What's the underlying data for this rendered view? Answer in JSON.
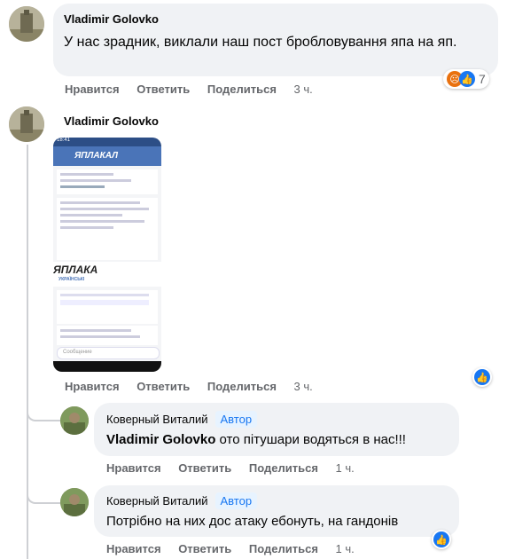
{
  "comments": [
    {
      "author": "Vladimir Golovko",
      "text": "У нас зрадник, виклали наш пост бробловування япа на яп.",
      "actions": {
        "like": "Нравится",
        "reply": "Ответить",
        "share": "Поделиться",
        "time": "3 ч."
      },
      "reaction_count": "7",
      "reaction_icons": [
        "angry-icon",
        "like-icon"
      ]
    },
    {
      "author": "Vladimir Golovko",
      "attachment": {
        "status_time": "18:41",
        "logo": "ЯПЛАКАЛ",
        "brand": "ЯПЛАКА",
        "brand_sub": "УКРАЇНСЬКІ",
        "composer_placeholder": "Сообщение"
      },
      "actions": {
        "like": "Нравится",
        "reply": "Ответить",
        "share": "Поделиться",
        "time": "3 ч."
      },
      "reaction_icons": [
        "like-icon"
      ]
    }
  ],
  "replies": [
    {
      "author": "Коверный Виталий",
      "badge": "Автор",
      "mention": "Vladimir Golovko",
      "text": " ото пітушари водяться в нас!!!",
      "actions": {
        "like": "Нравится",
        "reply": "Ответить",
        "share": "Поделиться",
        "time": "1 ч."
      }
    },
    {
      "author": "Коверный Виталий",
      "badge": "Автор",
      "text": "Потрібно на них дос атаку ебонуть, на гандонів",
      "actions": {
        "like": "Нравится",
        "reply": "Ответить",
        "share": "Поделиться",
        "time": "1 ч."
      },
      "reaction_icons": [
        "like-icon"
      ]
    }
  ],
  "colors": {
    "accent": "#1877f2",
    "bubble": "#f0f2f5",
    "muted": "#65676b",
    "phone_header": "#4a74b8"
  }
}
